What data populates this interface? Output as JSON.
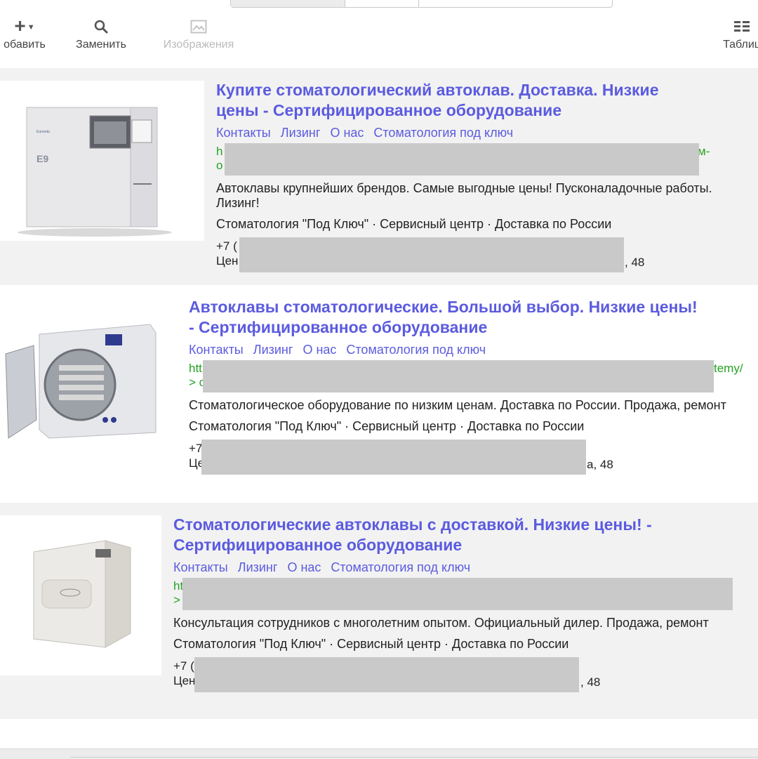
{
  "toolbar": {
    "add_label": "обавить",
    "replace_label": "Заменить",
    "images_label": "Изображения",
    "table_label": "Таблиц"
  },
  "ads": [
    {
      "title": "Купите стоматологический автоклав. Доставка. Низкие цены - Сертифицированное оборудование",
      "sitelinks": [
        "Контакты",
        "Лизинг",
        "О нас",
        "Стоматология под ключ"
      ],
      "url_line1_start": "h",
      "url_line1_end": "м-",
      "url_line2_start": "о",
      "text": "Автоклавы крупнейших брендов. Самые выгодные цены! Пусконаладочные работы. Лизинг!",
      "callouts": "Стоматология \"Под Ключ\" · Сервисный центр · Доставка по России",
      "phone_start": "+7 (",
      "address_start": "Цен",
      "address_end": ", 48",
      "image_label": "E9",
      "image_brand": "Euronda"
    },
    {
      "title": "Автоклавы стоматологические. Большой выбор. Низкие цены! - Сертифицированное оборудование",
      "sitelinks": [
        "Контакты",
        "Лизинг",
        "О нас",
        "Стоматология под ключ"
      ],
      "url_line1_start": "htt",
      "url_line1_end": "temy/",
      "url_line2_start": "> с",
      "text": "Стоматологическое оборудование по низким ценам. Доставка по России. Продажа, ремонт",
      "callouts": "Стоматология \"Под Ключ\" · Сервисный центр · Доставка по России",
      "phone_start": "+7",
      "address_start": "Це",
      "address_end": "а, 48"
    },
    {
      "title": "Стоматологические автоклавы с доставкой. Низкие цены! - Сертифицированное оборудование",
      "sitelinks": [
        "Контакты",
        "Лизинг",
        "О нас",
        "Стоматология под ключ"
      ],
      "url_line1_start": "ht",
      "url_line1_end": "",
      "url_line2_start": ">",
      "text": "Консультация сотрудников с многолетним опытом. Официальный дилер. Продажа, ремонт",
      "callouts": "Стоматология \"Под Ключ\" · Сервисный центр · Доставка по России",
      "phone_start": "+7 (",
      "address_start": "Цен",
      "address_end": ", 48"
    }
  ],
  "colors": {
    "title_link": "#5b5be0",
    "url_green": "#23a323",
    "redaction": "#c9c9c9",
    "row_alt_bg": "#f2f2f2"
  },
  "icons": {
    "add": "plus-icon",
    "replace": "magnifier-icon",
    "images": "image-icon",
    "table": "table-grid-icon"
  }
}
